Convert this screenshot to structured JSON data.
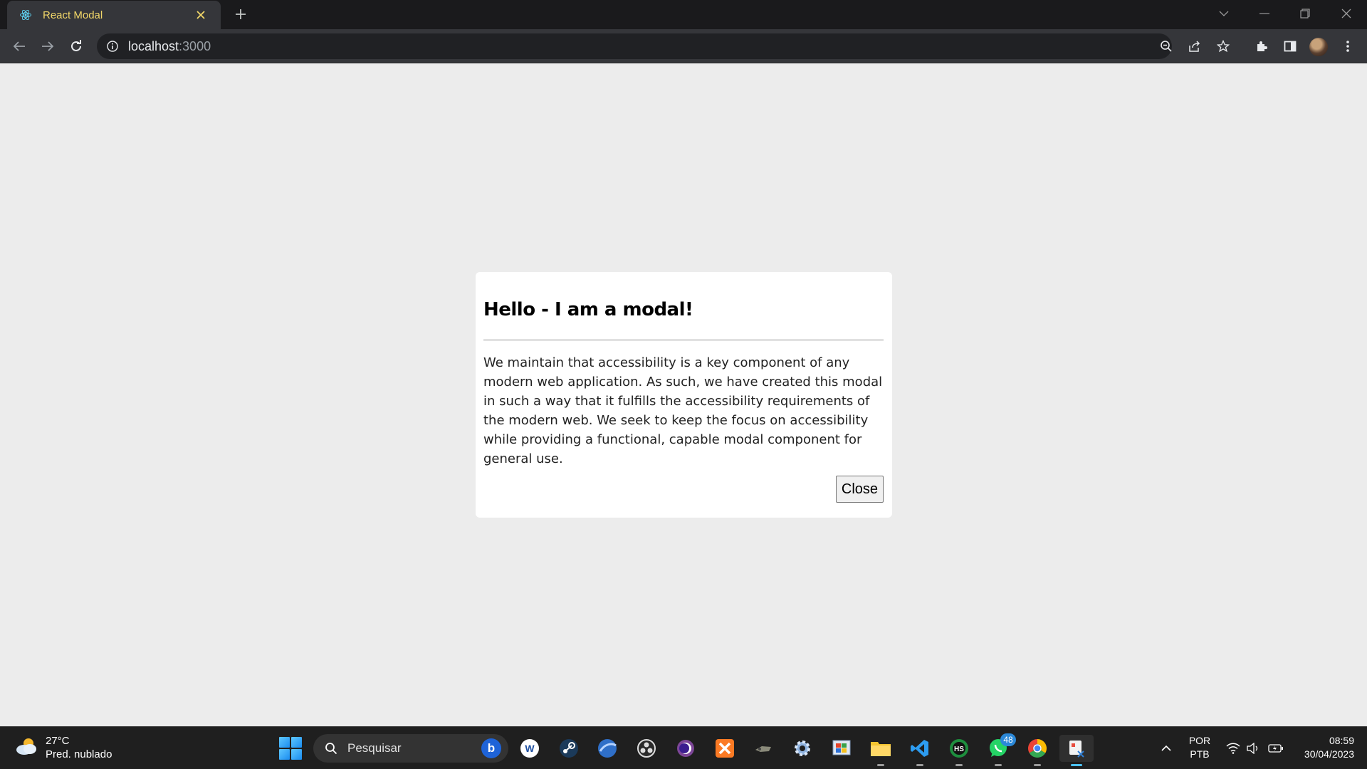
{
  "browser": {
    "tab_title": "React Modal",
    "url_host": "localhost",
    "url_port": ":3000",
    "icons": [
      "react-icon",
      "close-icon",
      "plus-icon",
      "back-icon",
      "forward-icon",
      "reload-icon",
      "info-icon",
      "zoom-icon",
      "share-icon",
      "star-icon",
      "extensions-icon",
      "sidepanel-icon",
      "menu-icon"
    ]
  },
  "modal": {
    "title": "Hello - I am a modal!",
    "body": "We maintain that accessibility is a key component of any modern web application. As such, we have created this modal in such a way that it fulfills the accessibility requirements of the modern web. We seek to keep the focus on accessibility while providing a functional, capable modal component for general use.",
    "close_label": "Close"
  },
  "taskbar": {
    "weather_temp": "27°C",
    "weather_desc": "Pred. nublado",
    "search_placeholder": "Pesquisar",
    "whatsapp_badge": "48",
    "lang_top": "POR",
    "lang_bottom": "PTB",
    "time": "08:59",
    "date": "30/04/2023"
  },
  "colors": {
    "tab_title": "#f2d769",
    "page_bg": "#ececec",
    "modal_bg": "#ffffff",
    "taskbar_bg": "#1f1f1f",
    "accent": "#4cc2ff"
  }
}
